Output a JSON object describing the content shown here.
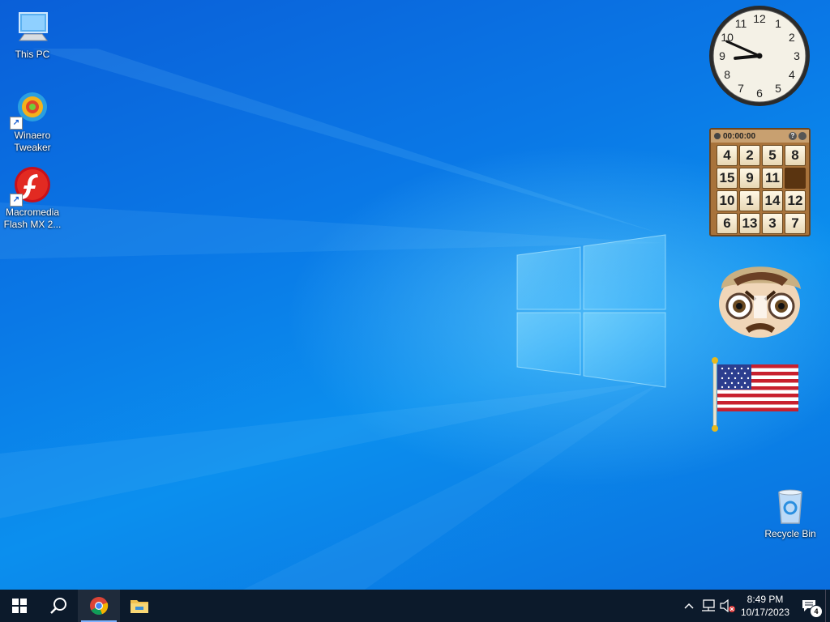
{
  "desktop": {
    "icons": [
      {
        "label_line1": "This PC",
        "label_line2": "",
        "icon": "this-pc-icon"
      },
      {
        "label_line1": "Winaero",
        "label_line2": "Tweaker",
        "icon": "winaero-tweaker-icon"
      },
      {
        "label_line1": "Macromedia",
        "label_line2": "Flash MX 2...",
        "icon": "flash-icon"
      },
      {
        "label_line1": "Recycle Bin",
        "label_line2": "",
        "icon": "recycle-bin-icon"
      }
    ]
  },
  "gadgets": {
    "clock": {
      "numerals": [
        "12",
        "1",
        "2",
        "3",
        "4",
        "5",
        "6",
        "7",
        "8",
        "9",
        "10",
        "11"
      ],
      "hour": 8,
      "minute": 49
    },
    "puzzle": {
      "timer": "00:00:00",
      "tiles": [
        "4",
        "2",
        "5",
        "8",
        "15",
        "9",
        "11",
        "",
        "10",
        "1",
        "14",
        "12",
        "6",
        "13",
        "3",
        "7"
      ]
    },
    "face": {
      "icon": "cartoon-face-gadget"
    },
    "flag": {
      "icon": "us-flag-gadget"
    }
  },
  "taskbar": {
    "start": "windows-start-icon",
    "search": "search-icon",
    "apps": [
      {
        "name": "Google Chrome",
        "icon": "chrome-icon",
        "active": true
      },
      {
        "name": "File Explorer",
        "icon": "file-explorer-icon",
        "active": false
      }
    ],
    "tray": {
      "time": "8:49 PM",
      "date": "10/17/2023",
      "notification_count": "4"
    }
  },
  "colors": {
    "accent": "#0a78e6",
    "taskbar": "#0c1a2b"
  }
}
